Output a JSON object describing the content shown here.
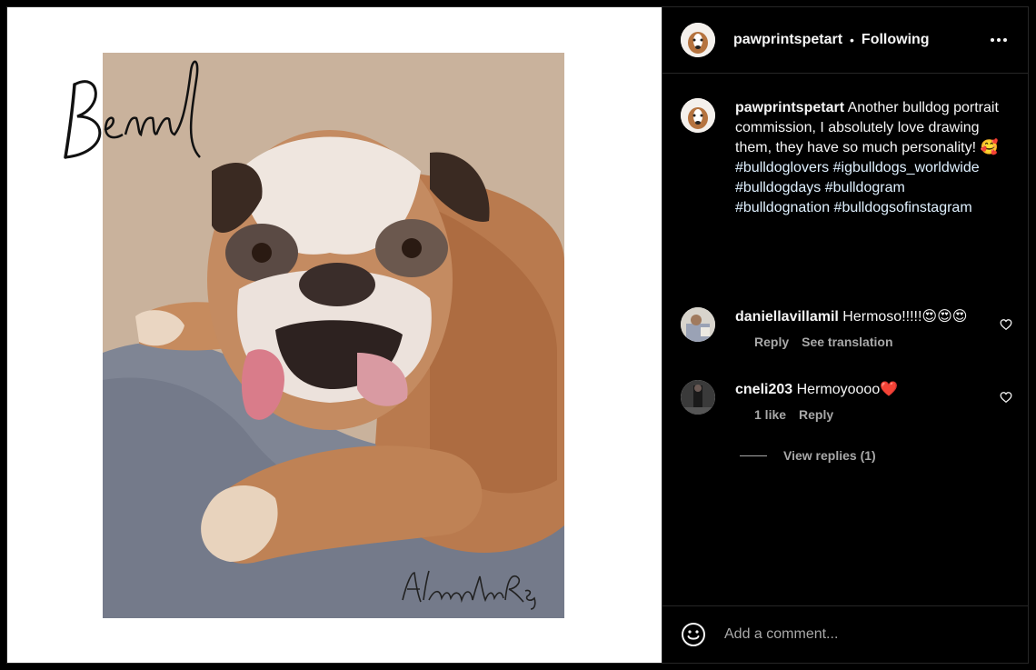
{
  "post": {
    "artwork_caption": "Benny",
    "artist_signature": "AlexandraRey"
  },
  "header": {
    "username": "pawprintspetart",
    "separator": "•",
    "follow_label": "Following",
    "more_icon": "more-horizontal-icon"
  },
  "caption": {
    "username": "pawprintspetart",
    "text": "Another bulldog portrait commission, I absolutely love drawing them, they have so much personality! 🥰",
    "hashtags": [
      "#bulldoglovers",
      "#igbulldogs_worldwide",
      "#bulldogdays",
      "#bulldogram",
      "#bulldognation",
      "#bulldogsofinstagram"
    ]
  },
  "comments": [
    {
      "username": "daniellavillamil",
      "text": "Hermoso!!!!!😍😍😍",
      "actions": [
        "Reply",
        "See translation"
      ]
    },
    {
      "username": "cneli203",
      "text": "Hermoyoooo❤️",
      "actions": [
        "1 like",
        "Reply"
      ]
    }
  ],
  "view_replies_label": "View replies (1)",
  "footer": {
    "emoji_icon": "smiley-icon",
    "comment_placeholder": "Add a comment..."
  }
}
